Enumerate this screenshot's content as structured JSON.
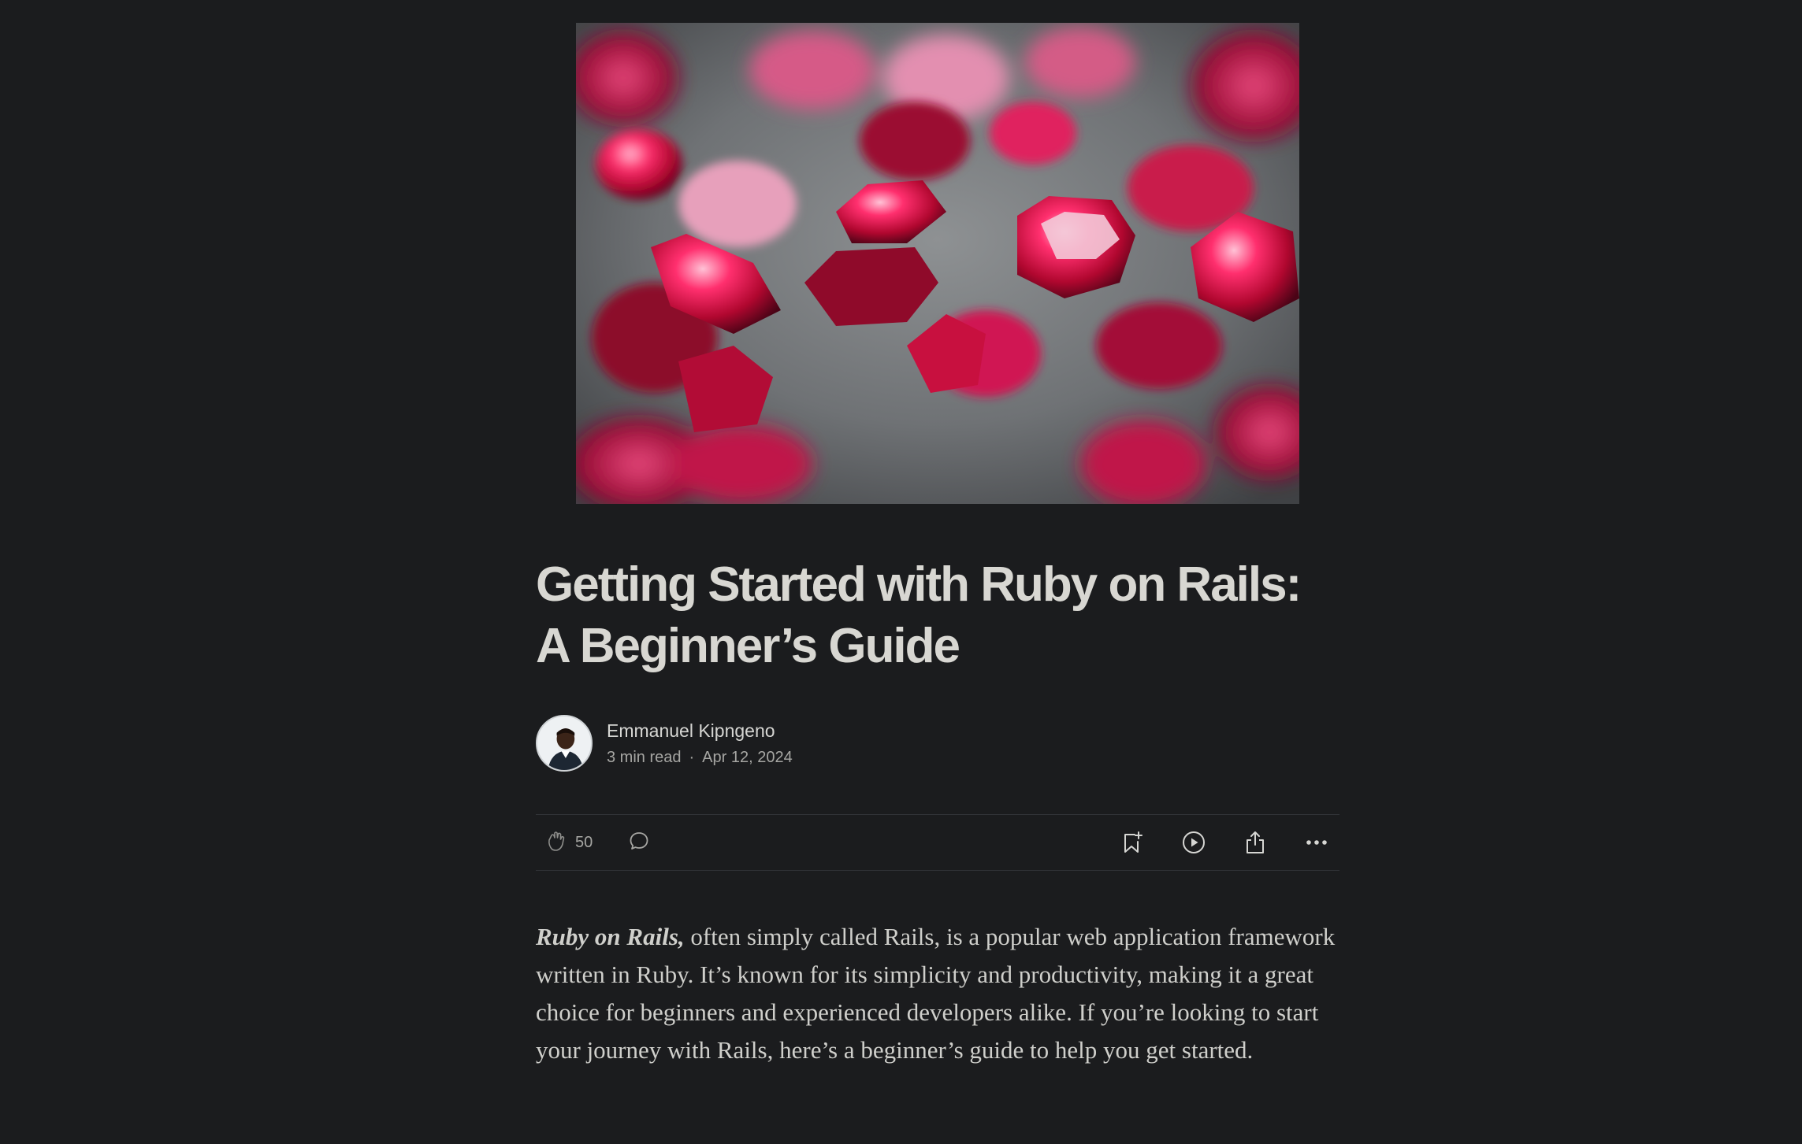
{
  "hero_image": {
    "alt": "Red gemstones on a grey surface"
  },
  "article": {
    "title": "Getting Started with Ruby on Rails: A Beginner’s Guide",
    "author": {
      "name": "Emmanuel Kipngeno"
    },
    "read_time": "3 min read",
    "separator": "·",
    "date": "Apr 12, 2024",
    "body": {
      "lead_emphasis": "Ruby on Rails,",
      "lead_rest": " often simply called Rails, is a popular web application framework written in Ruby. It’s known for its simplicity and productivity, making it a great choice for beginners and experienced developers alike. If you’re looking to start your journey with Rails, here’s a beginner’s guide to help you get started."
    }
  },
  "actions": {
    "clap_count": "50",
    "icons": {
      "clap": "clap-icon",
      "comment": "comment-icon",
      "bookmark": "bookmark-add-icon",
      "listen": "play-circle-icon",
      "share": "share-icon",
      "more": "more-horizontal-icon"
    }
  },
  "colors": {
    "background": "#1b1c1e",
    "title": "#d8d7d2",
    "body": "#cfcfcb",
    "muted": "#a6a6a3",
    "divider": "#303236",
    "gem": "#c8103f"
  }
}
